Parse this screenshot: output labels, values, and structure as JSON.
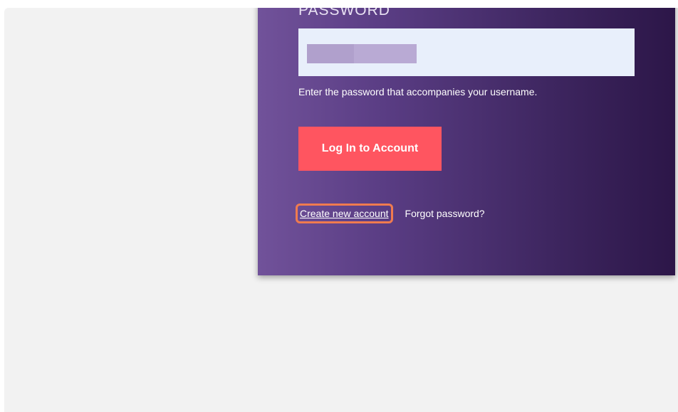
{
  "login_form": {
    "password_label": "PASSWORD",
    "password_help": "Enter the password that accompanies your username.",
    "login_button_label": "Log In to Account",
    "create_account_label": "Create new account",
    "forgot_password_label": "Forgot password?"
  },
  "colors": {
    "page_background": "#f2f2f2",
    "panel_gradient_start": "#71529a",
    "panel_gradient_end": "#2c1648",
    "input_background": "#e8effb",
    "button_background": "#ff5560",
    "highlight_outline": "#f07b4f"
  }
}
